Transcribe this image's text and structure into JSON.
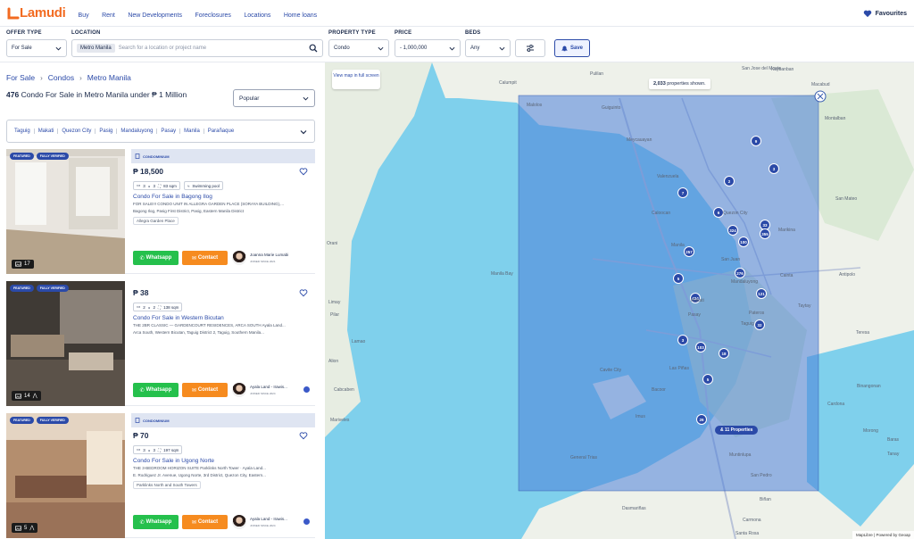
{
  "brand": {
    "name": "Lamudi",
    "color": "#f26b21"
  },
  "nav": [
    "Buy",
    "Rent",
    "New Developments",
    "Foreclosures",
    "Locations",
    "Home loans"
  ],
  "favourites_label": "Favourites",
  "filters": {
    "offer_type": {
      "label": "OFFER TYPE",
      "value": "For Sale"
    },
    "location": {
      "label": "LOCATION",
      "chip": "Metro Manila",
      "placeholder": "Search for a location or project name"
    },
    "property_type": {
      "label": "PROPERTY TYPE",
      "value": "Condo"
    },
    "price": {
      "label": "PRICE",
      "value": "- 1,000,000"
    },
    "beds": {
      "label": "BEDS",
      "value": "Any"
    },
    "save_label": "Save"
  },
  "breadcrumb": [
    "For Sale",
    "Condos",
    "Metro Manila"
  ],
  "results": {
    "count": "476",
    "text": "Condo For Sale in Metro Manila under ₱ 1 Million"
  },
  "sort": "Popular",
  "locations": [
    "Taguig",
    "Makati",
    "Quezon City",
    "Pasig",
    "Mandaluyong",
    "Pasay",
    "Manila",
    "Parañaque"
  ],
  "listings": [
    {
      "badges": [
        "FEATURED",
        "FULLY VERIFIED"
      ],
      "photos": "17",
      "type": "CONDOMINIUM",
      "price": "₱ 18,500",
      "beds": "3",
      "baths": "3",
      "area": "83 sqm",
      "amenity": "Swimming pool",
      "title": "Condo For Sale in Bagong Ilog",
      "desc": "FOR SALE!!! CONDO UNIT IN ALLEGRA GARDEN PLACE (SORAYA BUILDING),...",
      "address": "Bagong Ilog, Pasig First District, Pasig, Eastern Manila District",
      "project": "Allegra Garden Place",
      "agent": "Joanna Marie Lumabi",
      "joined": "JOINED SINCE 2021",
      "verified_agent": false
    },
    {
      "badges": [
        "FEATURED",
        "FULLY VERIFIED"
      ],
      "photos": "14",
      "type": "",
      "price": "₱ 38",
      "beds": "2",
      "baths": "2",
      "area": "138 sqm",
      "amenity": "",
      "title": "Condo For Sale in Western Bicutan",
      "desc": "THE 2BR CLASSIC — GARDENCOURT RESIDENCES, ARCA SOUTH Ayala Land...",
      "address": "Arca South, Western Bicutan, Taguig District 2, Taguig, Southern Manila...",
      "project": "",
      "agent": "Ayala Land - Irawis...",
      "joined": "JOINED SINCE 2024",
      "verified_agent": true
    },
    {
      "badges": [
        "FEATURED",
        "FULLY VERIFIED"
      ],
      "photos": "5",
      "type": "CONDOMINIUM",
      "price": "₱ 70",
      "beds": "3",
      "baths": "3",
      "area": "197 sqm",
      "amenity": "",
      "title": "Condo For Sale in Ugong Norte",
      "desc": "THE 3-BEDROOM HORIZON SUITE Parklinks North Tower · Ayala Land...",
      "address": "E. Rodriguez Jr. Avenue, Ugong Norte, 3rd District, Quezon City, Eastern...",
      "project": "Parklinks North and South Towers",
      "agent": "Ayala Land - Irawis...",
      "joined": "JOINED SINCE 2024",
      "verified_agent": true
    }
  ],
  "buttons": {
    "whatsapp": "Whatsapp",
    "contact": "Contact"
  },
  "map": {
    "view_full": "View map in full screen",
    "shown_count": "2,033",
    "shown_text": "properties shown.",
    "properties_pill": "& 11 Properties",
    "attribution": "MapLibre | Powered by Geoap",
    "clusters": [
      "9",
      "3",
      "2",
      "33",
      "355",
      "7",
      "6",
      "324",
      "100",
      "257",
      "276",
      "121",
      "424",
      "5",
      "32",
      "3",
      "103",
      "18",
      "5",
      "26"
    ],
    "labels": [
      "San Jose del Monte",
      "Macabud",
      "Kaybanban",
      "Malolos",
      "Pulilan",
      "Calumpit",
      "Guiguinto",
      "Meycauayan",
      "Valenzuela",
      "Caloocan",
      "Quezon City",
      "Marikina",
      "Manila",
      "Mandaluyong",
      "San Juan",
      "Makati",
      "Pasay",
      "Pateros",
      "Taguig",
      "Cavite City",
      "Las Piñas",
      "Bacoor",
      "Imus",
      "General Trias",
      "Muntinlupa",
      "San Pedro",
      "Dasmariñas",
      "Carmona",
      "Antipolo",
      "Manila Bay",
      "Orani",
      "Pilar",
      "Limay",
      "Lamao",
      "Alion",
      "Cabcaben",
      "Mariveles",
      "San Mateo",
      "Montalban",
      "Taytay",
      "Cainta",
      "Biñan",
      "Santa Rosa",
      "Binangonan",
      "Cardona",
      "Morong",
      "Baras",
      "Tanay",
      "Teresa"
    ]
  }
}
